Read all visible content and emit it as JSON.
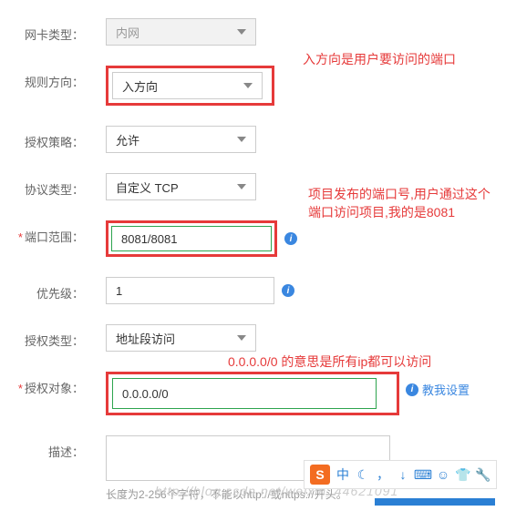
{
  "labels": {
    "cardType": "网卡类型：",
    "direction": "规则方向：",
    "policy": "授权策略：",
    "protocol": "协议类型：",
    "portRange": "端口范围：",
    "priority": "优先级：",
    "authType": "授权类型：",
    "authObject": "授权对象：",
    "desc": "描述："
  },
  "values": {
    "cardType": "内网",
    "direction": "入方向",
    "policy": "允许",
    "protocol": "自定义 TCP",
    "portRange": "8081/8081",
    "priority": "1",
    "authType": "地址段访问",
    "authObject": "0.0.0.0/0"
  },
  "annotations": {
    "a1": "入方向是用户要访问的端口",
    "a2": "项目发布的端口号,用户通过这个端口访问项目,我的是8081",
    "a3": "0.0.0.0/0   的意思是所有ip都可以访问"
  },
  "hint": "长度为2-256个字符，不能以http://或https://开头。",
  "teach": "教我设置",
  "im_toolbar": {
    "logo": "S",
    "lang": "中"
  },
  "watermark": "http://blog.csdn.net/weixin_44621091"
}
